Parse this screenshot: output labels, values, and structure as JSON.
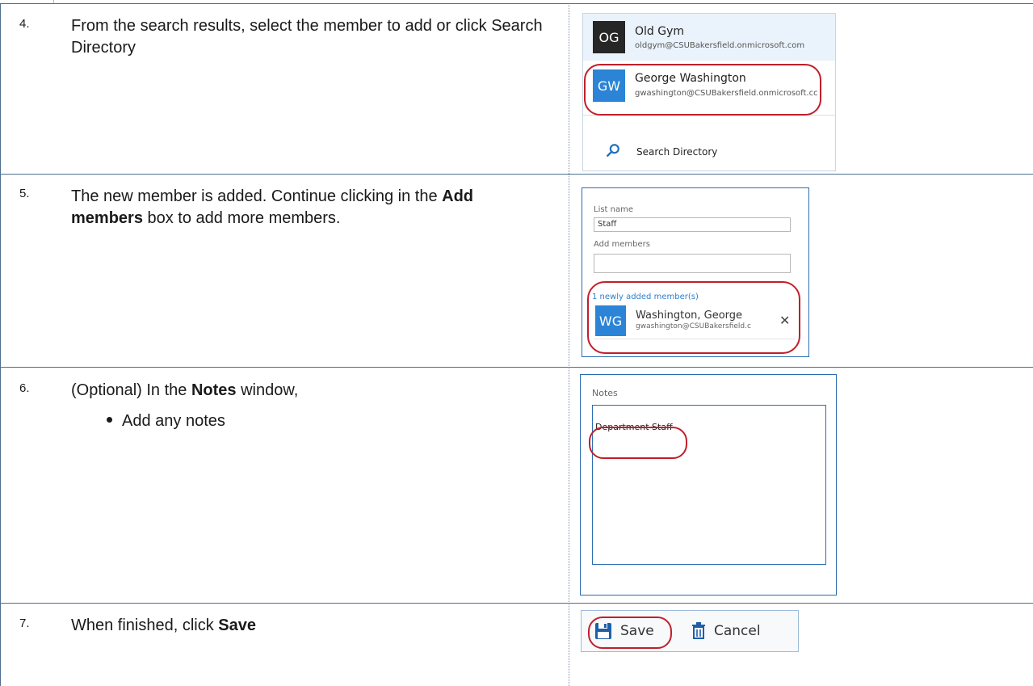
{
  "steps": [
    {
      "number": "4.",
      "text": "From the search results, select the member to add or click Search Directory"
    },
    {
      "number": "5.",
      "text_before": "The new member is added. Continue clicking in the ",
      "bold": "Add members",
      "text_after": " box to add more members."
    },
    {
      "number": "6.",
      "text_before": "(Optional) In the ",
      "bold": "Notes",
      "text_after": " window,",
      "bullets": [
        "Add any notes"
      ]
    },
    {
      "number": "7.",
      "text_before": "When finished, click ",
      "bold": "Save"
    }
  ],
  "search_results": {
    "items": [
      {
        "initials": "OG",
        "name": "Old Gym",
        "email": "oldgym@CSUBakersfield.onmicrosoft.com",
        "avatar_color": "#262626"
      },
      {
        "initials": "GW",
        "name": "George Washington",
        "email": "gwashington@CSUBakersfield.onmicrosoft.cc",
        "avatar_color": "#2b84d6"
      }
    ],
    "search_directory_label": "Search Directory",
    "search_icon": "search-icon"
  },
  "list_form": {
    "list_name_label": "List name",
    "list_name_value": "Staff",
    "add_members_label": "Add members",
    "add_members_value": "",
    "newly_added_label": "1 newly added member(s)",
    "member": {
      "initials": "WG",
      "name": "Washington, George",
      "email": "gwashington@CSUBakersfield.c",
      "avatar_color": "#2b84d6",
      "remove_icon": "close-icon"
    }
  },
  "notes": {
    "label": "Notes",
    "value": "Department Staff"
  },
  "toolbar": {
    "save_label": "Save",
    "save_icon": "floppy-disk-icon",
    "cancel_label": "Cancel",
    "cancel_icon": "trash-icon"
  },
  "colors": {
    "accent_blue": "#2b84d6",
    "highlight_red": "#c01f2a",
    "table_border": "#4f6f8f"
  }
}
